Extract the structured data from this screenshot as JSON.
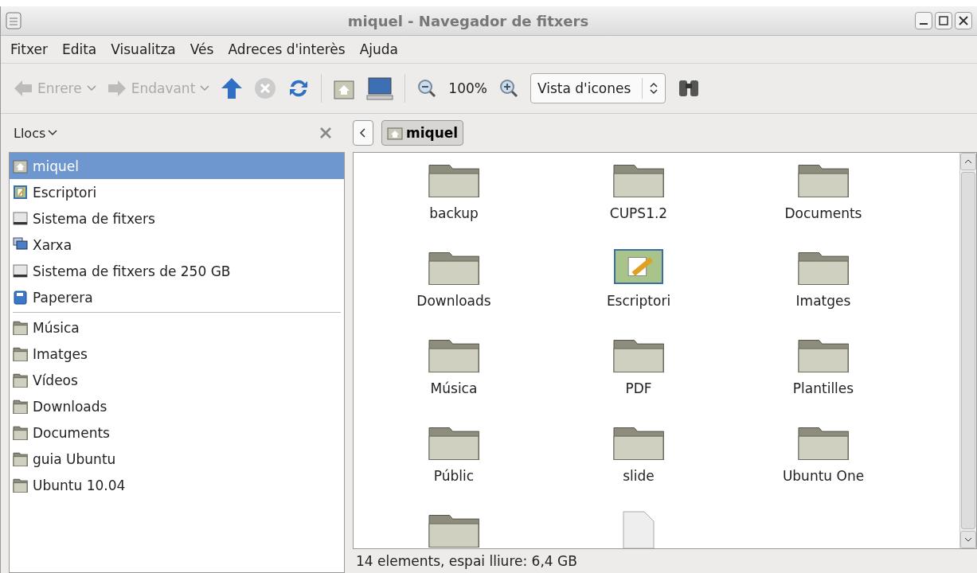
{
  "window": {
    "title": "miquel - Navegador de fitxers"
  },
  "menu": [
    "Fitxer",
    "Edita",
    "Visualitza",
    "Vés",
    "Adreces d'interès",
    "Ajuda"
  ],
  "toolbar": {
    "back": {
      "label": "Enrere",
      "disabled": true
    },
    "forward": {
      "label": "Endavant",
      "disabled": true
    },
    "zoom": "100%",
    "view_select": {
      "value": "Vista d'icones"
    }
  },
  "sidebar": {
    "title": "Llocs",
    "places": [
      {
        "label": "miquel",
        "kind": "home",
        "selected": true
      },
      {
        "label": "Escriptori",
        "kind": "desktop",
        "selected": false
      },
      {
        "label": "Sistema de fitxers",
        "kind": "drive",
        "selected": false
      },
      {
        "label": "Xarxa",
        "kind": "network",
        "selected": false
      },
      {
        "label": "Sistema de fitxers de 250 GB",
        "kind": "drive",
        "selected": false
      },
      {
        "label": "Paperera",
        "kind": "trash",
        "selected": false
      }
    ],
    "bookmarks": [
      {
        "label": "Música",
        "kind": "folder",
        "selected": false
      },
      {
        "label": "Imatges",
        "kind": "folder",
        "selected": false
      },
      {
        "label": "Vídeos",
        "kind": "folder",
        "selected": false
      },
      {
        "label": "Downloads",
        "kind": "folder",
        "selected": false
      },
      {
        "label": "Documents",
        "kind": "folder",
        "selected": false
      },
      {
        "label": "guia Ubuntu",
        "kind": "folder",
        "selected": false
      },
      {
        "label": "Ubuntu 10.04",
        "kind": "folder",
        "selected": false
      }
    ]
  },
  "path_bar": {
    "current": "miquel"
  },
  "files": [
    {
      "name": "backup",
      "kind": "folder"
    },
    {
      "name": "CUPS1.2",
      "kind": "folder"
    },
    {
      "name": "Documents",
      "kind": "folder"
    },
    {
      "name": "Downloads",
      "kind": "folder"
    },
    {
      "name": "Escriptori",
      "kind": "desktop"
    },
    {
      "name": "Imatges",
      "kind": "folder"
    },
    {
      "name": "Música",
      "kind": "folder"
    },
    {
      "name": "PDF",
      "kind": "folder"
    },
    {
      "name": "Plantilles",
      "kind": "folder"
    },
    {
      "name": "Públic",
      "kind": "folder"
    },
    {
      "name": "slide",
      "kind": "folder"
    },
    {
      "name": "Ubuntu One",
      "kind": "folder"
    },
    {
      "kind": "folder"
    },
    {
      "kind": "file"
    }
  ],
  "status_bar": "14 elements, espai lliure: 6,4 GB"
}
